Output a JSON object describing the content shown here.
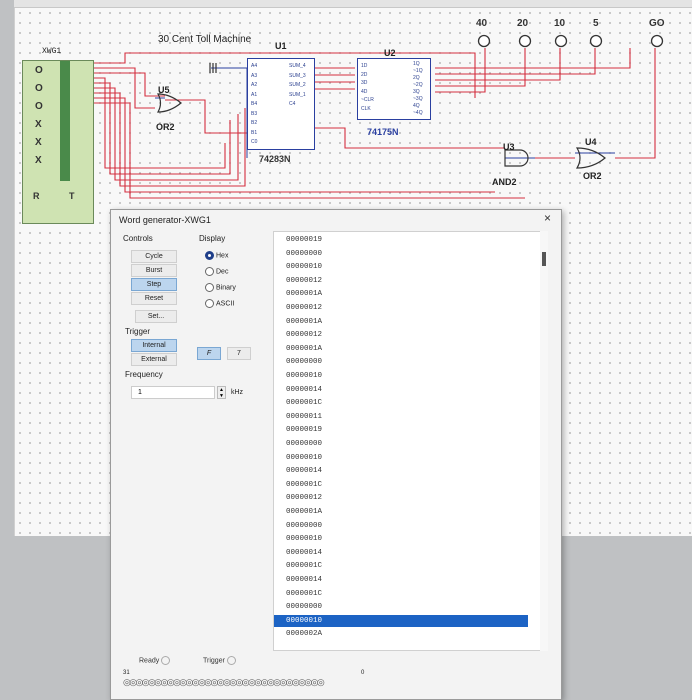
{
  "circuit": {
    "title": "30 Cent Toll Machine",
    "u1": {
      "ref": "U1",
      "part": "74283N",
      "pins_left": [
        "A4",
        "A3",
        "A2",
        "A1",
        "B4",
        "B3",
        "B2",
        "B1",
        "C0"
      ],
      "pins_right": [
        "SUM_4",
        "SUM_3",
        "SUM_2",
        "SUM_1",
        "C4"
      ]
    },
    "u2": {
      "ref": "U2",
      "part": "74175N",
      "pins_left": [
        "1D",
        "2D",
        "3D",
        "4D",
        "~CLR",
        "CLK"
      ],
      "pins_right": [
        "1Q",
        "~1Q",
        "2Q",
        "~2Q",
        "3Q",
        "~3Q",
        "4Q",
        "~4Q"
      ]
    },
    "u3": {
      "ref": "U3",
      "part": "AND2"
    },
    "u4": {
      "ref": "U4",
      "part": "OR2"
    },
    "u5": {
      "ref": "U5",
      "part": "OR2"
    },
    "probes": [
      "40",
      "20",
      "10",
      "5",
      "GO"
    ],
    "xwg": {
      "ref": "XWG1",
      "leds": [
        "O",
        "O",
        "O",
        "X",
        "X",
        "X"
      ],
      "bottom_left": "R",
      "bottom_right": "T"
    }
  },
  "dialog": {
    "title": "Word generator-XWG1",
    "close": "×",
    "controls": {
      "label": "Controls",
      "buttons": [
        "Cycle",
        "Burst",
        "Step",
        "Reset"
      ],
      "selected": "Step",
      "set_button": "Set..."
    },
    "display": {
      "label": "Display",
      "options": [
        "Hex",
        "Dec",
        "Binary",
        "ASCII"
      ],
      "selected": "Hex"
    },
    "trigger": {
      "label": "Trigger",
      "internal": "Internal",
      "external": "External",
      "rising": "F",
      "falling": "7"
    },
    "frequency": {
      "label": "Frequency",
      "value": "1",
      "unit": "kHz"
    },
    "words": [
      "00000019",
      "00000000",
      "00000010",
      "00000012",
      "0000001A",
      "00000012",
      "0000001A",
      "00000012",
      "0000001A",
      "00000000",
      "00000010",
      "00000014",
      "0000001C",
      "00000011",
      "00000019",
      "00000000",
      "00000010",
      "00000014",
      "0000001C",
      "00000012",
      "0000001A",
      "00000000",
      "00000010",
      "00000014",
      "0000001C",
      "00000014",
      "0000001C",
      "00000000",
      "00000010",
      "0000002A"
    ],
    "highlighted_index": 28,
    "status": {
      "ready": "Ready",
      "trigger": "Trigger",
      "bit_left": "31",
      "bit_right": "0"
    },
    "bit_pattern": "◎◎◎◎◎◎◎◎◎◎◎◎◎◎◎◎◎◎◎◎◎◎◎◎◎◎◎◎◎◎◎◎"
  }
}
